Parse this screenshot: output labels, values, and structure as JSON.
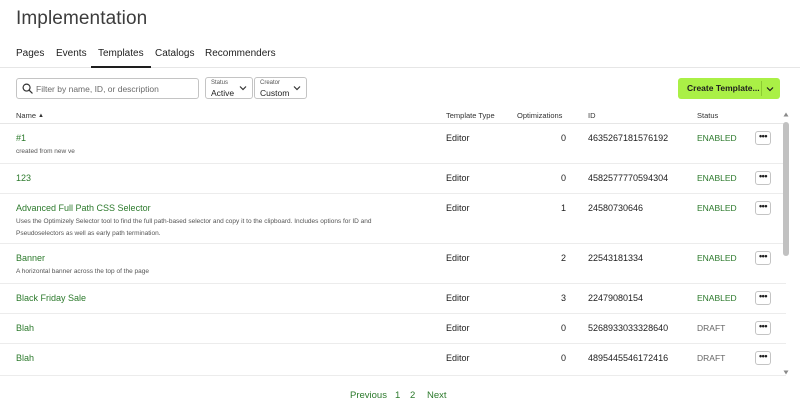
{
  "page": {
    "title": "Implementation"
  },
  "tabs": [
    {
      "label": "Pages"
    },
    {
      "label": "Events"
    },
    {
      "label": "Templates"
    },
    {
      "label": "Catalogs"
    },
    {
      "label": "Recommenders"
    }
  ],
  "active_tab": "Templates",
  "filter": {
    "placeholder": "Filter by name, ID, or description",
    "value": ""
  },
  "status_dropdown": {
    "label": "Status",
    "value": "Active"
  },
  "creator_dropdown": {
    "label": "Creator",
    "value": "Custom"
  },
  "create_button": {
    "label": "Create Template..."
  },
  "columns": {
    "name": "Name",
    "type": "Template Type",
    "optimizations": "Optimizations",
    "id": "ID",
    "status": "Status"
  },
  "sort": {
    "column": "Name",
    "direction": "ascending"
  },
  "rows": [
    {
      "name": "#1",
      "description": "created from new ve",
      "type": "Editor",
      "optimizations": "0",
      "id": "4635267181576192",
      "status": "ENABLED",
      "more": "•••"
    },
    {
      "name": "123",
      "description": "",
      "type": "Editor",
      "optimizations": "0",
      "id": "4582577770594304",
      "status": "ENABLED",
      "more": "•••"
    },
    {
      "name": "Advanced Full Path CSS Selector",
      "description": "Uses the Optimizely Selector tool to find the full path-based selector and copy it to the clipboard. Includes options for ID and Pseudoselectors as well as early path termination.",
      "type": "Editor",
      "optimizations": "1",
      "id": "24580730646",
      "status": "ENABLED",
      "more": "•••"
    },
    {
      "name": "Banner",
      "description": "A horizontal banner across the top of the page",
      "type": "Editor",
      "optimizations": "2",
      "id": "22543181334",
      "status": "ENABLED",
      "more": "•••"
    },
    {
      "name": "Black Friday Sale",
      "description": "",
      "type": "Editor",
      "optimizations": "3",
      "id": "22479080154",
      "status": "ENABLED",
      "more": "•••"
    },
    {
      "name": "Blah",
      "description": "",
      "type": "Editor",
      "optimizations": "0",
      "id": "5268933033328640",
      "status": "DRAFT",
      "more": "•••"
    },
    {
      "name": "Blah",
      "description": "",
      "type": "Editor",
      "optimizations": "0",
      "id": "4895445546172416",
      "status": "DRAFT",
      "more": "•••"
    }
  ],
  "pagination": {
    "previous": "Previous",
    "pages": [
      "1",
      "2"
    ],
    "next": "Next"
  },
  "colors": {
    "accent": "#aaf046",
    "link": "#2c7a2c",
    "enabled": "#2c7a2c",
    "draft": "#666666"
  },
  "icons": {
    "search": "search-icon",
    "dropdown": "chevron-down-icon",
    "more": "more-horizontal-icon",
    "sort": "sort-ascending-icon"
  }
}
